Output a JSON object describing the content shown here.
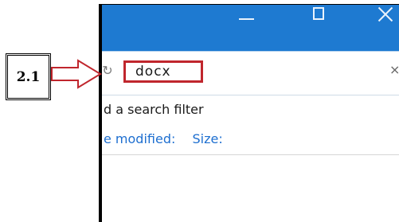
{
  "callout": {
    "label": "2.1"
  },
  "window": {
    "buttons": [
      "minimize",
      "maximize",
      "close"
    ]
  },
  "search": {
    "value": "docx",
    "clear_glyph": "×"
  },
  "hint_text": "d a search filter",
  "filters": {
    "date_label": "e modified:",
    "size_label": "Size:"
  },
  "colors": {
    "titlebar": "#1e7ad1",
    "highlight": "#c0262d",
    "link": "#1e6fd0"
  },
  "icons": {
    "refresh": "refresh-icon",
    "clear": "close-icon"
  }
}
